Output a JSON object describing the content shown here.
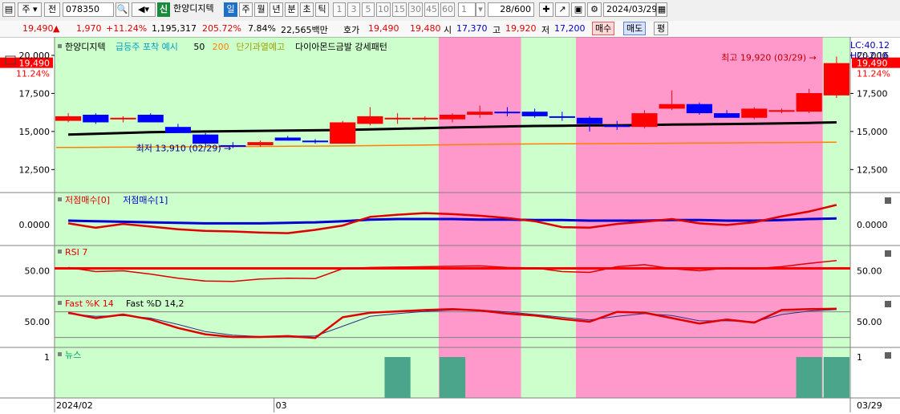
{
  "toolbar": {
    "market": "주",
    "mode": "전",
    "code": "078350",
    "sin_badge": "신",
    "stock_name": "한양디지텍",
    "periods": [
      "일",
      "주",
      "월",
      "년",
      "분",
      "초",
      "틱"
    ],
    "active_period": "일",
    "intervals": [
      "1",
      "3",
      "5",
      "10",
      "15",
      "30",
      "45",
      "60"
    ],
    "interval_value": "1",
    "count": "28/600",
    "date": "2024/03/29"
  },
  "quote": {
    "price": "19,490",
    "change": "1,970",
    "change_pct": "+11.24%",
    "volume": "1,195,317",
    "volume_ratio": "205.72%",
    "turnover": "7.84%",
    "amount": "22,565백만",
    "hoga_label": "호가",
    "ask": "19,490",
    "bid": "19,480",
    "open_label": "시",
    "open": "17,370",
    "high_label": "고",
    "high": "19,920",
    "low_label": "저",
    "low": "17,200",
    "buy_label": "매수",
    "sell_label": "매도",
    "extra_label": "평"
  },
  "legend": {
    "price": [
      {
        "text": "한양디지텍",
        "color": "#000000"
      },
      {
        "text": "급등주 포착 예시",
        "color": "#00a0c0"
      },
      {
        "text": "50",
        "color": "#000000"
      },
      {
        "text": "200",
        "color": "#ff8000"
      },
      {
        "text": "단기과열예고",
        "color": "#a0a000"
      },
      {
        "text": "다이아몬드금발 강세패턴",
        "color": "#000000"
      }
    ],
    "lowbuy": [
      {
        "text": "저점매수[0]",
        "color": "#e00000"
      },
      {
        "text": "저점매수[1]",
        "color": "#0000d0"
      }
    ],
    "rsi": [
      {
        "text": "RSI 7",
        "color": "#e00000"
      }
    ],
    "stoch": [
      {
        "text": "Fast %K 14",
        "color": "#e00000"
      },
      {
        "text": "Fast %D 14,2",
        "color": "#000000"
      }
    ],
    "news": [
      {
        "text": "뉴스",
        "color": "#00a060"
      }
    ]
  },
  "annotations": {
    "lc": "LC:40.12",
    "hc": "HC:-2.16",
    "high_note": "최고 19,920 (03/29) →",
    "low_note": "최저 13,910 (02/29) →",
    "current_price": "19,490",
    "current_pct": "11.24%"
  },
  "axes": {
    "price_ticks": [
      "20,000",
      "17,500",
      "15,000",
      "12,500"
    ],
    "price_values": [
      20000,
      17500,
      15000,
      12500
    ],
    "lowbuy_tick": "0.0000",
    "rsi_tick": "50.00",
    "stoch_tick": "50.00",
    "news_tick": "1",
    "x_labels": [
      {
        "text": "2024/02",
        "index": 0
      },
      {
        "text": "03",
        "index": 8
      }
    ],
    "x_end_label": "03/29"
  },
  "colors": {
    "up": "#ff0000",
    "down": "#0000ff",
    "green_bg": "#ccffcc",
    "pink_bg": "#ff99cc",
    "ma50": "#000000",
    "ma200": "#ff8000",
    "news_bar": "#4ba58a"
  },
  "chart_data": {
    "type": "candlestick",
    "bg_segments": [
      {
        "from": 0,
        "to": 13,
        "color": "green"
      },
      {
        "from": 14,
        "to": 16,
        "color": "pink"
      },
      {
        "from": 17,
        "to": 18,
        "color": "green"
      },
      {
        "from": 19,
        "to": 27,
        "color": "pink"
      },
      {
        "from": 28,
        "to": 28,
        "color": "green"
      }
    ],
    "candles": [
      {
        "o": 15700,
        "h": 16200,
        "l": 15600,
        "c": 16000
      },
      {
        "o": 16100,
        "h": 16200,
        "l": 15500,
        "c": 15600
      },
      {
        "o": 15800,
        "h": 16000,
        "l": 15600,
        "c": 15900
      },
      {
        "o": 16100,
        "h": 16200,
        "l": 15600,
        "c": 15600
      },
      {
        "o": 15300,
        "h": 15500,
        "l": 14900,
        "c": 14900
      },
      {
        "o": 14800,
        "h": 14900,
        "l": 14100,
        "c": 14200
      },
      {
        "o": 14100,
        "h": 14300,
        "l": 13910,
        "c": 14000
      },
      {
        "o": 14100,
        "h": 14400,
        "l": 14000,
        "c": 14300
      },
      {
        "o": 14600,
        "h": 14700,
        "l": 14400,
        "c": 14400
      },
      {
        "o": 14400,
        "h": 14500,
        "l": 14200,
        "c": 14300
      },
      {
        "o": 14200,
        "h": 15700,
        "l": 14200,
        "c": 15600
      },
      {
        "o": 15500,
        "h": 16600,
        "l": 15400,
        "c": 16000
      },
      {
        "o": 15900,
        "h": 16200,
        "l": 15500,
        "c": 15900
      },
      {
        "o": 15800,
        "h": 16000,
        "l": 15700,
        "c": 15900
      },
      {
        "o": 15800,
        "h": 16200,
        "l": 15600,
        "c": 16100
      },
      {
        "o": 16100,
        "h": 16700,
        "l": 15900,
        "c": 16300
      },
      {
        "o": 16300,
        "h": 16600,
        "l": 16000,
        "c": 16200
      },
      {
        "o": 16300,
        "h": 16500,
        "l": 15900,
        "c": 16000
      },
      {
        "o": 16000,
        "h": 16300,
        "l": 15700,
        "c": 15900
      },
      {
        "o": 15900,
        "h": 16000,
        "l": 15000,
        "c": 15500
      },
      {
        "o": 15400,
        "h": 15700,
        "l": 15100,
        "c": 15300
      },
      {
        "o": 15300,
        "h": 16400,
        "l": 15200,
        "c": 16200
      },
      {
        "o": 16500,
        "h": 17700,
        "l": 16400,
        "c": 16800
      },
      {
        "o": 16800,
        "h": 16900,
        "l": 16100,
        "c": 16200
      },
      {
        "o": 16200,
        "h": 16400,
        "l": 15900,
        "c": 15900
      },
      {
        "o": 15900,
        "h": 16600,
        "l": 15800,
        "c": 16500
      },
      {
        "o": 16300,
        "h": 16500,
        "l": 16200,
        "c": 16400
      },
      {
        "o": 16300,
        "h": 17800,
        "l": 16200,
        "c": 17520
      },
      {
        "o": 17370,
        "h": 19920,
        "l": 17200,
        "c": 19490
      }
    ],
    "ma50": [
      14800,
      14850,
      14900,
      14950,
      14980,
      15000,
      15020,
      15040,
      15060,
      15080,
      15100,
      15140,
      15180,
      15220,
      15260,
      15300,
      15330,
      15360,
      15380,
      15400,
      15400,
      15420,
      15450,
      15470,
      15490,
      15510,
      15530,
      15560,
      15600
    ],
    "ma200": [
      13950,
      13960,
      13970,
      13980,
      13990,
      14000,
      14010,
      14020,
      14030,
      14040,
      14050,
      14070,
      14090,
      14110,
      14130,
      14150,
      14170,
      14180,
      14190,
      14200,
      14210,
      14220,
      14230,
      14240,
      14250,
      14260,
      14270,
      14280,
      14300
    ],
    "lowbuy0": [
      0.2,
      -0.6,
      0.1,
      -0.4,
      -0.9,
      -1.2,
      -1.3,
      -1.5,
      -1.6,
      -1.0,
      -0.2,
      1.4,
      1.8,
      2.1,
      1.9,
      1.6,
      1.2,
      0.6,
      -0.5,
      -0.6,
      0.1,
      0.5,
      1.0,
      0.2,
      -0.1,
      0.4,
      1.5,
      2.4,
      3.6
    ],
    "lowbuy1": [
      0.7,
      0.6,
      0.5,
      0.4,
      0.3,
      0.2,
      0.2,
      0.2,
      0.3,
      0.4,
      0.6,
      0.9,
      1.0,
      1.0,
      1.0,
      0.9,
      0.9,
      0.8,
      0.8,
      0.7,
      0.7,
      0.7,
      0.8,
      0.8,
      0.7,
      0.7,
      0.8,
      1.0,
      1.1
    ],
    "rsi": [
      58,
      48,
      50,
      42,
      32,
      25,
      24,
      30,
      32,
      31,
      55,
      58,
      59,
      60,
      61,
      62,
      58,
      57,
      48,
      46,
      60,
      65,
      55,
      50,
      57,
      55,
      60,
      68,
      75
    ],
    "rsi_level": 56,
    "stoch_k": [
      70,
      58,
      66,
      55,
      36,
      22,
      16,
      16,
      18,
      14,
      60,
      70,
      73,
      76,
      78,
      75,
      68,
      64,
      56,
      50,
      72,
      70,
      58,
      46,
      55,
      48,
      76,
      78,
      79
    ],
    "stoch_d": [
      68,
      62,
      64,
      58,
      44,
      28,
      20,
      17,
      18,
      18,
      40,
      62,
      68,
      73,
      76,
      76,
      72,
      66,
      60,
      54,
      62,
      68,
      64,
      52,
      52,
      50,
      66,
      74,
      77
    ],
    "stoch_level": 72,
    "news": [
      0,
      0,
      0,
      0,
      0,
      0,
      0,
      0,
      0,
      0,
      0,
      0,
      1,
      0,
      1,
      0,
      0,
      0,
      0,
      0,
      0,
      0,
      0,
      0,
      0,
      0,
      0,
      1,
      1
    ]
  }
}
